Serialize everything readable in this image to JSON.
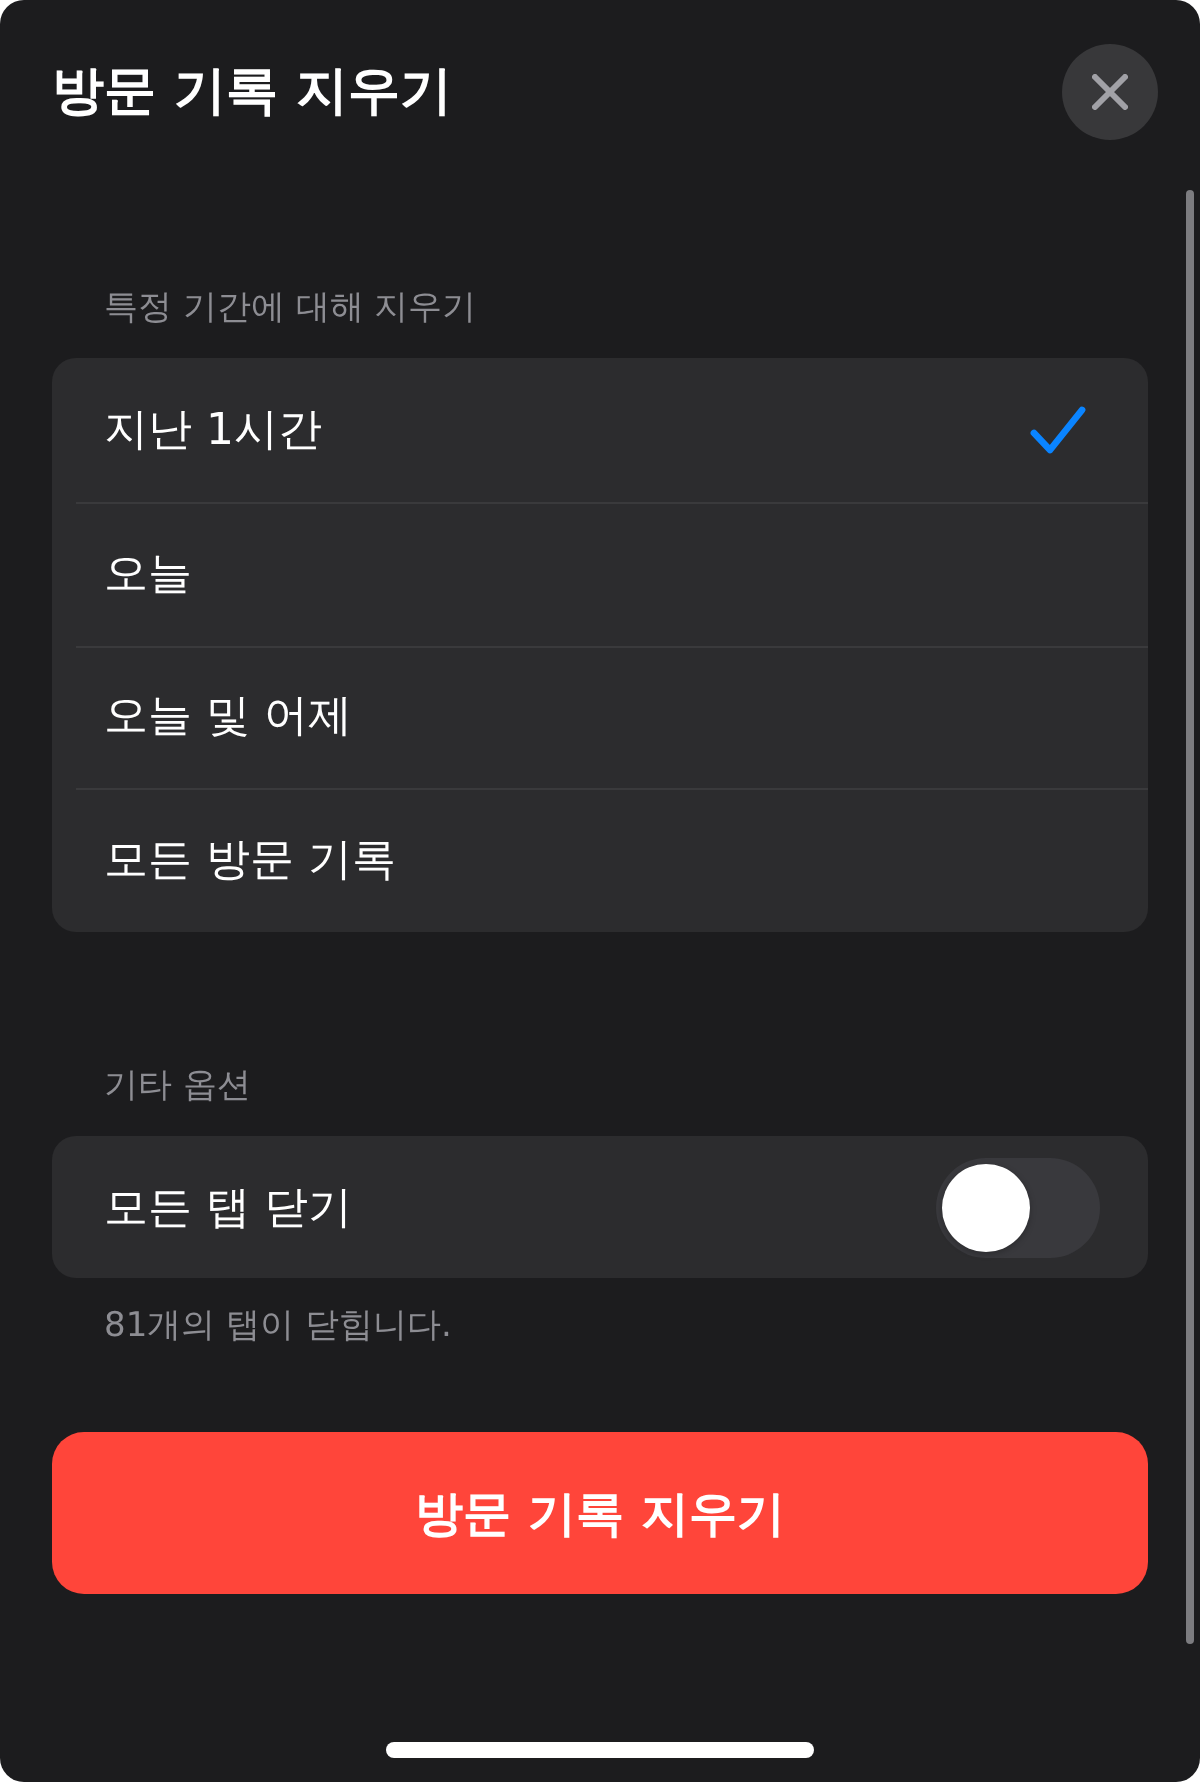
{
  "sheet": {
    "title": "방문 기록 지우기"
  },
  "sections": [
    {
      "kind": "choice",
      "header": "특정 기간에 대해 지우기",
      "items": [
        {
          "label": "지난 1시간",
          "selected": true
        },
        {
          "label": "오늘",
          "selected": false
        },
        {
          "label": "오늘 및 어제",
          "selected": false
        },
        {
          "label": "모든 방문 기록",
          "selected": false
        }
      ]
    },
    {
      "kind": "toggle",
      "header": "기타 옵션",
      "items": [
        {
          "label": "모든 탭 닫기",
          "on": false
        }
      ],
      "footer": "81개의 탭이 닫힙니다."
    }
  ],
  "primary_button": {
    "label": "방문 기록 지우기"
  }
}
